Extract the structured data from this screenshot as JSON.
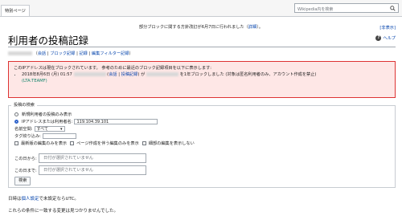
{
  "tabs": {
    "special": "特別ページ"
  },
  "search": {
    "placeholder": "Wikipedia内を検索"
  },
  "sitenotice": {
    "text": "部分ブロックに関する方針改訂が6月7日に行われました（",
    "link": "詳細",
    "suffix": "）。"
  },
  "hide_link": "[非表示]",
  "help": {
    "label": "ヘルプ",
    "icon": "question-icon"
  },
  "page": {
    "title": "利用者の投稿記録"
  },
  "subtitle": {
    "prefix": "（",
    "links": [
      "会話",
      "ブロック記録",
      "記録",
      "編集フィルター記録"
    ],
    "sep": " | ",
    "suffix": "）"
  },
  "notice": {
    "line1": "このIPアドレスは現在ブロックされています。 参考のために最近のブロック記録項目を以下に表示します:",
    "entry_time": "2018年8月6日 (月) 01:57",
    "entry_talk": "会話",
    "entry_contribs": "投稿記録",
    "entry_mid": "が",
    "entry_rest": "を1年ブロックしました (対象は匿名利用者のみ、アカウント作成を禁止)",
    "entry_reason": "(LTA:TEAMF)"
  },
  "form": {
    "legend": "投稿の検索",
    "radio_newbies": "新規利用者の投稿のみ表示",
    "radio_ip": "IPアドレスまたは利用者名:",
    "ip_value": "119.104.39.101",
    "namespace_label": "名前空間:",
    "namespace_value": "すべて",
    "tag_label": "タグ絞り込み:",
    "check_latest": "最新版の編集のみを表示",
    "check_newpages": "ページ作成を伴う編集のみを表示",
    "check_minor": "細部の編集を表示しない",
    "from_label": "この日から:",
    "to_label": "この日まで:",
    "date_placeholder": "日付が選択されていません",
    "submit": "検索"
  },
  "footer": {
    "time_prefix": "日時は",
    "time_link": "個人設定",
    "time_suffix": "で未設定ならUTC。",
    "no_results": "これらの条件に一致する変更は見つかりませんでした。"
  }
}
